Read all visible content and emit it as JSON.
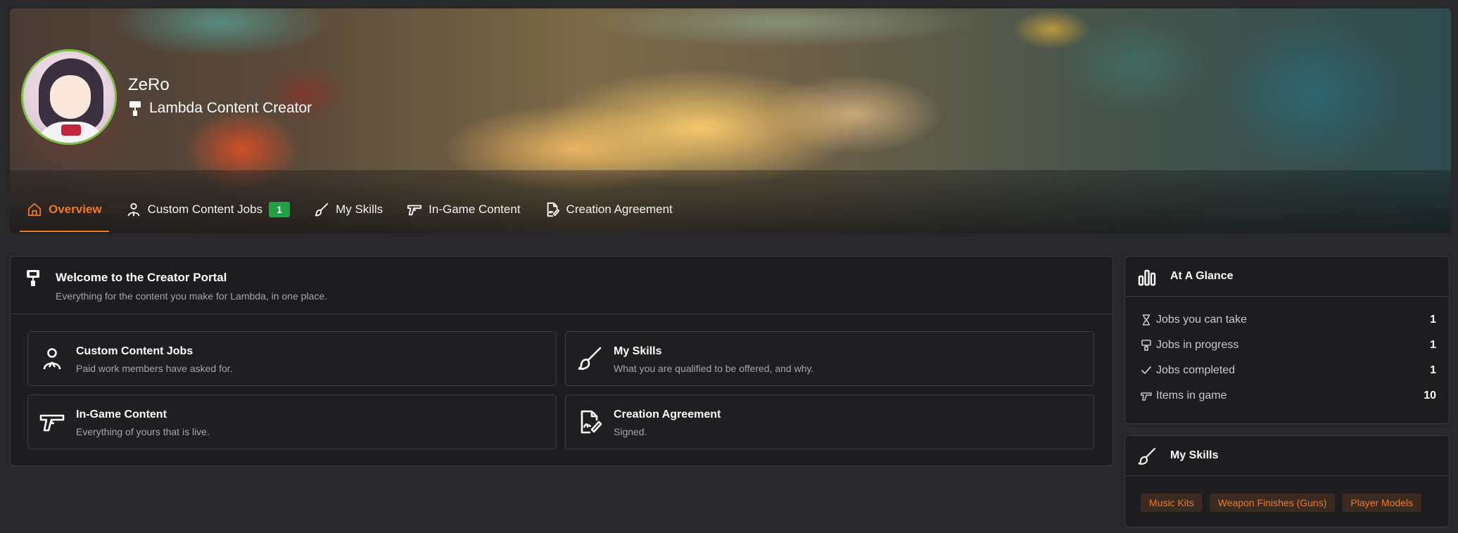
{
  "profile": {
    "name": "ZeRo",
    "role": "Lambda Content Creator"
  },
  "tabs": [
    {
      "label": "Overview",
      "icon": "home-icon",
      "active": true
    },
    {
      "label": "Custom Content Jobs",
      "icon": "worker-icon",
      "badge": "1"
    },
    {
      "label": "My Skills",
      "icon": "brush-icon"
    },
    {
      "label": "In-Game Content",
      "icon": "gun-icon"
    },
    {
      "label": "Creation Agreement",
      "icon": "signed-document-icon"
    }
  ],
  "welcome": {
    "title": "Welcome to the Creator Portal",
    "subtitle": "Everything for the content you make for Lambda, in one place.",
    "tiles": [
      {
        "title": "Custom Content Jobs",
        "desc": "Paid work members have asked for.",
        "icon": "worker-icon"
      },
      {
        "title": "My Skills",
        "desc": "What you are qualified to be offered, and why.",
        "icon": "brush-icon"
      },
      {
        "title": "In-Game Content",
        "desc": "Everything of yours that is live.",
        "icon": "gun-icon"
      },
      {
        "title": "Creation Agreement",
        "desc": "Signed.",
        "icon": "signed-document-icon"
      }
    ]
  },
  "glance": {
    "title": "At A Glance",
    "stats": [
      {
        "label": "Jobs you can take",
        "value": "1",
        "icon": "hourglass-icon"
      },
      {
        "label": "Jobs in progress",
        "value": "1",
        "icon": "paint-roller-icon"
      },
      {
        "label": "Jobs completed",
        "value": "1",
        "icon": "check-icon"
      },
      {
        "label": "Items in game",
        "value": "10",
        "icon": "gun-icon"
      }
    ]
  },
  "skills": {
    "title": "My Skills",
    "chips": [
      "Music Kits",
      "Weapon Finishes (Guns)",
      "Player Models"
    ]
  },
  "colors": {
    "accent": "#f07a1a",
    "badge_green": "#21a048",
    "avatar_ring": "#7bc043",
    "card_bg": "#1d1d1f",
    "page_bg": "#28282a"
  }
}
